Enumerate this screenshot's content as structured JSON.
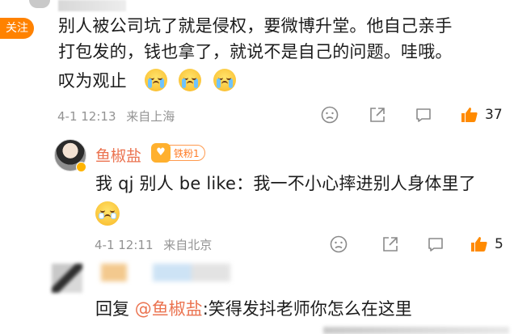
{
  "follow_badge": "关注",
  "comment1": {
    "lines": [
      "别人被公司坑了就是侵权，要微博升堂。他自己亲手",
      "打包发的，钱也拿了，就说不是自己的问题。哇哦。",
      "叹为观止"
    ],
    "timestamp": "4-1 12:13",
    "location": "来自上海",
    "likes": "37"
  },
  "reply": {
    "username": "鱼椒盐",
    "fan_badge": "铁粉1",
    "text": "我 qj 别人 be like：我一不小心摔进别人身体里了",
    "timestamp": "4-1 12:11",
    "location": "来自北京",
    "likes": "5"
  },
  "comment2": {
    "prefix": "回复",
    "mention": "@鱼椒盐",
    "text": ":笑得发抖老师你怎么在这里"
  },
  "colors": {
    "accent": "#eb7350",
    "like": "#ff8a00",
    "meta": "#939393",
    "follow": "#ff8200"
  },
  "icons": [
    "dislike-icon",
    "comment-icon",
    "share-icon",
    "like-icon",
    "crying-emoji-icon",
    "pleading-emoji-icon"
  ]
}
